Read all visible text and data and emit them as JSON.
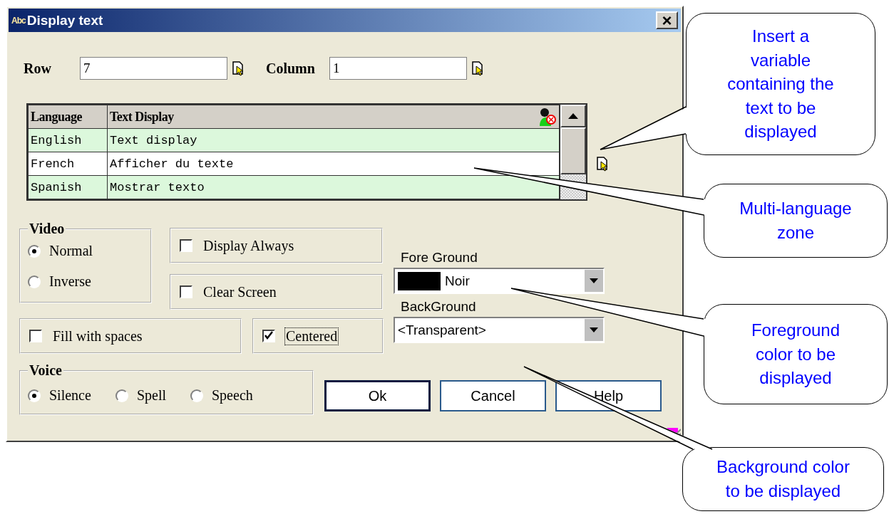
{
  "window": {
    "icon": "Abc",
    "title": "Display text",
    "close": "×"
  },
  "row_field": {
    "label": "Row",
    "value": "7"
  },
  "column_field": {
    "label": "Column",
    "value": "1"
  },
  "table": {
    "columns": [
      "Language",
      "Text Display"
    ],
    "rows": [
      {
        "cells": [
          "English",
          "Text display"
        ],
        "selected": false
      },
      {
        "cells": [
          "French",
          "Afficher du texte"
        ],
        "selected": true
      },
      {
        "cells": [
          "Spanish",
          "Mostrar texto"
        ],
        "selected": false
      }
    ]
  },
  "video": {
    "label": "Video",
    "options": [
      {
        "label": "Normal",
        "selected": true
      },
      {
        "label": "Inverse",
        "selected": false
      }
    ]
  },
  "checkboxes": [
    {
      "label": "Display Always",
      "checked": false,
      "focused": false
    },
    {
      "label": "Clear Screen",
      "checked": false,
      "focused": false
    },
    {
      "label": "Fill with spaces",
      "checked": false,
      "focused": false
    },
    {
      "label": "Centered",
      "checked": true,
      "focused": true
    }
  ],
  "foreground": {
    "label": "Fore Ground",
    "value": "Noir",
    "color": "#000000"
  },
  "background": {
    "label": "BackGround",
    "value": "<Transparent>"
  },
  "voice": {
    "label": "Voice",
    "options": [
      {
        "label": "Silence",
        "selected": true
      },
      {
        "label": "Spell",
        "selected": false
      },
      {
        "label": "Speech",
        "selected": false
      }
    ]
  },
  "buttons": [
    {
      "label": "Ok",
      "default": true
    },
    {
      "label": "Cancel",
      "default": false
    },
    {
      "label": "Help",
      "default": false
    }
  ],
  "callouts": [
    {
      "text": "Insert a variable containing the text to be displayed"
    },
    {
      "text": "Multi-language zone"
    },
    {
      "text": "Foreground color to be displayed"
    },
    {
      "text": "Background color to be displayed"
    }
  ]
}
